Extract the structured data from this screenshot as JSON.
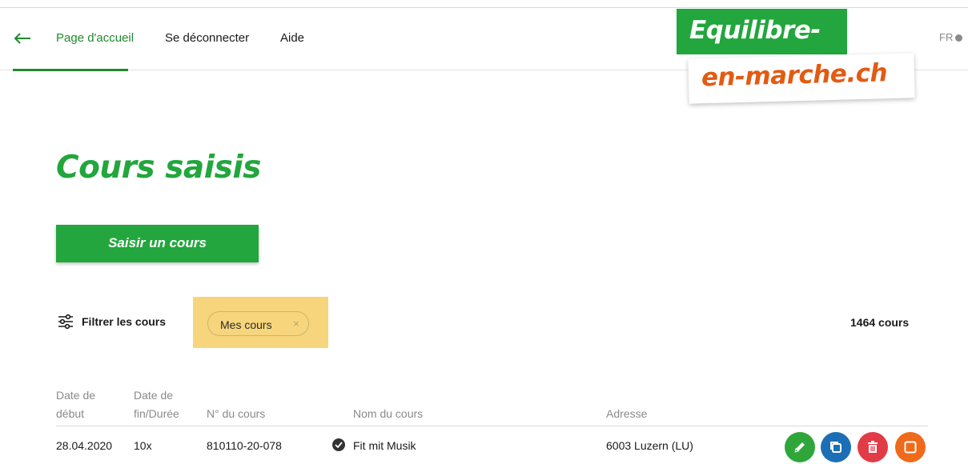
{
  "nav": {
    "links": [
      "Page d'accueil",
      "Se déconnecter",
      "Aide"
    ],
    "language": "FR"
  },
  "logo": {
    "line1": "Equilibre-",
    "line2": "en-marche.ch"
  },
  "page": {
    "title": "Cours saisis",
    "add_button": "Saisir un cours"
  },
  "filter": {
    "label": "Filtrer les cours",
    "chip": "Mes cours",
    "chip_close": "×",
    "count": "1464 cours"
  },
  "table": {
    "headers": [
      {
        "line1": "Date de",
        "line2": "début"
      },
      {
        "line1": "Date de",
        "line2": "fin/Durée"
      },
      {
        "line1": "",
        "line2": "N° du cours"
      },
      {
        "line1": "",
        "line2": "Nom du cours"
      },
      {
        "line1": "",
        "line2": "Adresse"
      }
    ],
    "rows": [
      {
        "start": "28.04.2020",
        "end": "10x",
        "number": "810110-20-078",
        "name": "Fit mit Musik",
        "address": "6003 Luzern (LU)"
      }
    ]
  },
  "colors": {
    "brand_green": "#22a63d",
    "nav_active": "#1f8a2e",
    "logo_orange": "#e35a12",
    "chip_highlight": "#f6d57c",
    "edit_action": "#2fa63a",
    "copy_action": "#1c6fb5",
    "delete_action": "#e23b46",
    "archive_action": "#ef6a1a"
  },
  "icons": {
    "back": "arrow-left-icon",
    "filter": "sliders-icon",
    "status": "check-circle-icon",
    "actions": [
      "pencil-icon",
      "copy-icon",
      "trash-icon",
      "square-icon"
    ]
  }
}
